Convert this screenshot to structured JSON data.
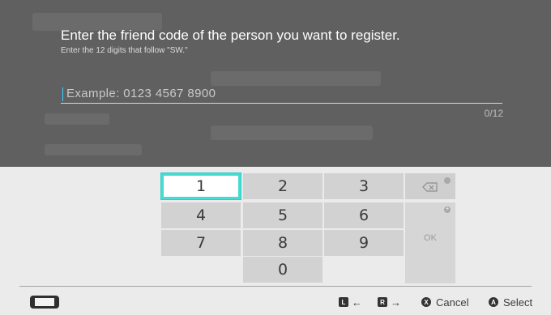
{
  "dialog": {
    "title": "Enter the friend code of the person you want to register.",
    "subtitle": "Enter the 12 digits that follow \"SW.\"",
    "input_placeholder": "Example: 0123 4567 8900",
    "counter": "0/12"
  },
  "keypad": {
    "keys": [
      "1",
      "2",
      "3",
      "4",
      "5",
      "6",
      "7",
      "8",
      "9",
      "0"
    ],
    "ok_label": "OK",
    "selected_key": "1"
  },
  "footer": {
    "hint_left_button": "L",
    "hint_left_arrow": "←",
    "hint_right_button": "R",
    "hint_right_arrow": "→",
    "cancel_button": "X",
    "cancel_label": "Cancel",
    "select_button": "A",
    "select_label": "Select"
  },
  "colors": {
    "accent": "#46dcd2",
    "dim": "#606060",
    "keyboard_bg": "#ebebeb"
  }
}
